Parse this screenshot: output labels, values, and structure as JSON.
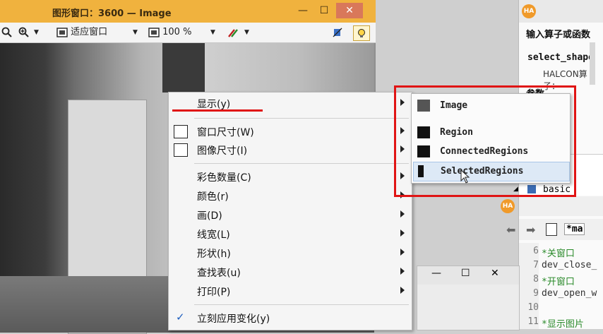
{
  "graphics_window": {
    "title": "图形窗口：3600 — Image",
    "toolbar": {
      "fit_window_label": "适应窗口",
      "zoom_value": "100 %"
    }
  },
  "right_window": {
    "header_label": "输入算子或函数",
    "operator": "select_shape",
    "halcon_label": "HALCON算子：",
    "params_label": "参数",
    "tree_item": "basic",
    "tab_label": "*ma",
    "code_lines": [
      {
        "num": "6",
        "text": "*关窗口"
      },
      {
        "num": "7",
        "text": "dev_close_"
      },
      {
        "num": "8",
        "text": "*开窗口"
      },
      {
        "num": "9",
        "text": "dev_open_w"
      },
      {
        "num": "10",
        "text": ""
      },
      {
        "num": "11",
        "text": "*显示图片"
      }
    ]
  },
  "context_menu": {
    "items": [
      {
        "label": "显示(y)"
      },
      {
        "label": "窗口尺寸(W)"
      },
      {
        "label": "图像尺寸(I)"
      },
      {
        "label": "彩色数量(C)"
      },
      {
        "label": "颜色(r)"
      },
      {
        "label": "画(D)"
      },
      {
        "label": "线宽(L)"
      },
      {
        "label": "形状(h)"
      },
      {
        "label": "查找表(u)"
      },
      {
        "label": "打印(P)"
      },
      {
        "label": "立刻应用变化(y)"
      }
    ]
  },
  "submenu": {
    "items": [
      {
        "label": "Image"
      },
      {
        "label": "Region"
      },
      {
        "label": "ConnectedRegions"
      },
      {
        "label": "SelectedRegions"
      }
    ]
  },
  "colors": {
    "title_bar": "#f0b23e",
    "annotation_red": "#e01414",
    "highlight": "#dde9f6",
    "halcon_badge": "#f09a2a"
  },
  "badges": {
    "ha": "HA"
  }
}
